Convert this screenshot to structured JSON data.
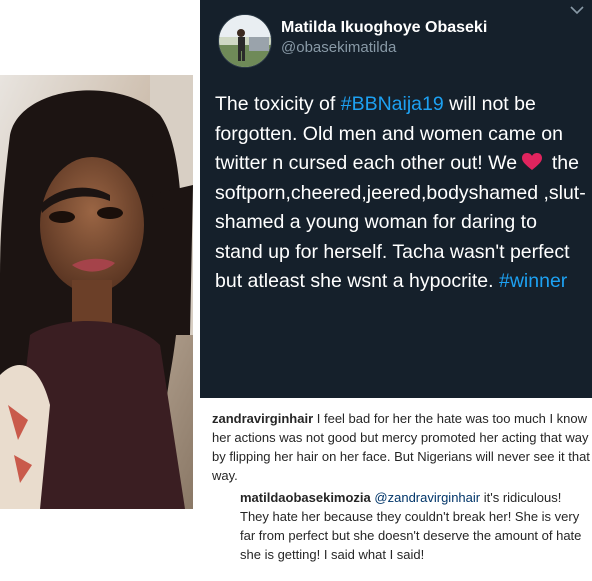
{
  "tweet": {
    "name": "Matilda Ikuoghoye Obaseki",
    "handle": "@obasekimatilda",
    "text_1": "The toxicity of ",
    "hashtag_1": "#BBNaija19",
    "text_2": " will not be forgotten. Old men and women came on twitter n cursed each other out! We ",
    "heart_icon": "red-heart-emoji",
    "text_3": " the softporn,cheered,jeered,bodyshamed ,slut-shamed a young woman for daring to stand up for herself. Tacha wasn't perfect but atleast she wsnt a hypocrite. ",
    "hashtag_2": "#winner"
  },
  "comments": [
    {
      "username": "zandravirginhair",
      "text": " I feel bad for her the hate was too much I know her actions was not good but mercy promoted her acting that way by flipping her hair on her face. But Nigerians will never see it that way."
    },
    {
      "username": "matildaobasekimozia",
      "mention": "@zandravirginhair",
      "text": " it's ridiculous! They hate her because they couldn't break her! She is very far from perfect but she doesn't deserve the amount of hate she is getting! I said what I said!"
    }
  ],
  "colors": {
    "tweet_background": "#15202b",
    "hashtag": "#1da1f2",
    "handle": "#8899a6",
    "heart": "#e0245e"
  }
}
